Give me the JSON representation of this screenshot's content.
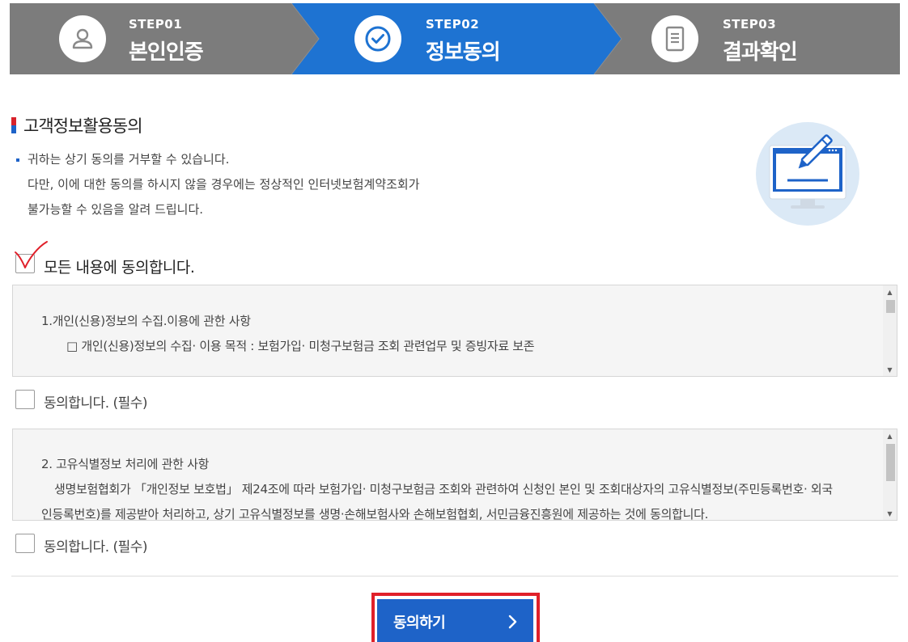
{
  "steps": [
    {
      "code": "STEP01",
      "title": "본인인증",
      "icon": "user-icon",
      "active": false
    },
    {
      "code": "STEP02",
      "title": "정보동의",
      "icon": "check-circle-icon",
      "active": true
    },
    {
      "code": "STEP03",
      "title": "결과확인",
      "icon": "document-icon",
      "active": false
    }
  ],
  "colors": {
    "stepper_bg": "#7c7c7c",
    "active_step": "#1e73d2",
    "primary": "#1e63c8",
    "highlight_frame": "#e0202a"
  },
  "section": {
    "title": "고객정보활용동의",
    "notice": [
      "귀하는 상기 동의를 거부할 수 있습니다.",
      "다만, 이에 대한 동의를 하시지 않을 경우에는 정상적인 인터넷보험계약조회가",
      "불가능할 수 있음을 알려 드립니다."
    ]
  },
  "agree_all": {
    "label": "모든 내용에 동의합니다.",
    "checked": true
  },
  "terms": [
    {
      "heading": "1.개인(신용)정보의 수집.이용에 관한 사항",
      "lines": [
        "□ 개인(신용)정보의 수집‧ 이용 목적 : 보험가입‧ 미청구보험금 조회 관련업무 및 증빙자료 보존"
      ],
      "checkbox_label": "동의합니다. (필수)"
    },
    {
      "heading": "2. 고유식별정보 처리에 관한 사항",
      "lines": [
        "생명보험협회가 「개인정보 보호법」 제24조에 따라 보험가입‧ 미청구보험금 조회와 관련하여 신청인 본인 및 조회대상자의 고유식별정보(주민등록번호‧ 외국",
        "인등록번호)를 제공받아 처리하고, 상기 고유식별정보를 생명‧손해보험사와 손해보험협회, 서민금융진흥원에 제공하는 것에 동의합니다."
      ],
      "checkbox_label": "동의합니다. (필수)"
    }
  ],
  "submit": {
    "label": "동의하기",
    "icon": "chevron-right-icon"
  }
}
